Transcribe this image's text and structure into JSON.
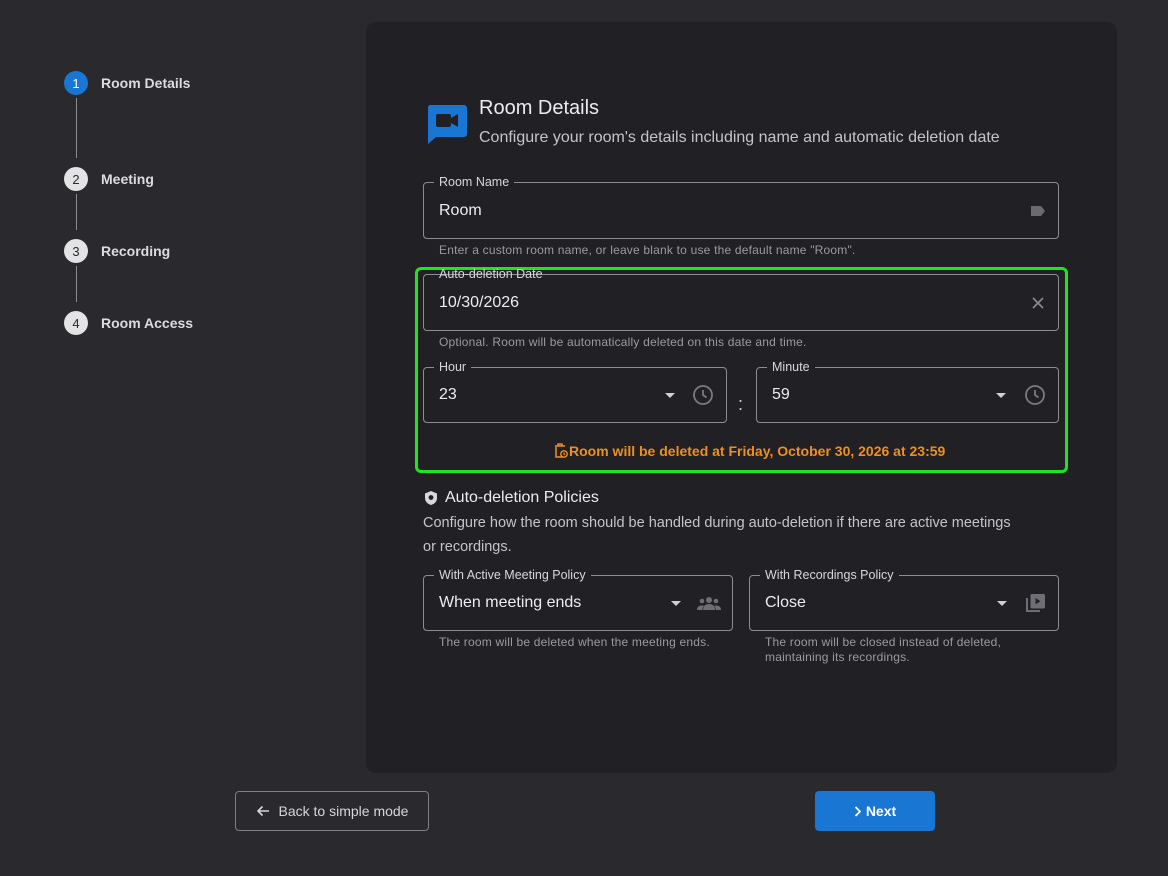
{
  "stepper": {
    "steps": [
      {
        "number": "1",
        "label": "Room Details"
      },
      {
        "number": "2",
        "label": "Meeting"
      },
      {
        "number": "3",
        "label": "Recording"
      },
      {
        "number": "4",
        "label": "Room Access"
      }
    ],
    "active_step": 1
  },
  "header": {
    "icon": "videocam-chat-icon",
    "title": "Room Details",
    "subtitle": "Configure your room's details including name and automatic deletion date"
  },
  "room_name": {
    "label": "Room Name",
    "value": "Room",
    "icon": "label-icon",
    "hint": "Enter a custom room name, or leave blank to use the default name \"Room\"."
  },
  "auto_deletion": {
    "label": "Auto-deletion Date",
    "value": "10/30/2026",
    "hint": "Optional. Room will be automatically deleted on this date and time.",
    "hour": {
      "label": "Hour",
      "value": "23"
    },
    "minute": {
      "label": "Minute",
      "value": "59"
    },
    "separator": ":",
    "warning": "Room will be deleted at Friday, October 30, 2026 at 23:59"
  },
  "policies": {
    "title": "Auto-deletion Policies",
    "description": "Configure how the room should be handled during auto-deletion if there are active meetings or recordings.",
    "meeting": {
      "label": "With Active Meeting Policy",
      "value": "When meeting ends",
      "hint": "The room will be deleted when the meeting ends."
    },
    "recordings": {
      "label": "With Recordings Policy",
      "value": "Close",
      "hint": "The room will be closed instead of deleted, maintaining its recordings."
    }
  },
  "footer": {
    "back_label": "Back to simple mode",
    "next_label": "Next"
  },
  "colors": {
    "accent": "#1976d2",
    "highlight": "#1ee61e",
    "warning": "#ef8f1e"
  }
}
